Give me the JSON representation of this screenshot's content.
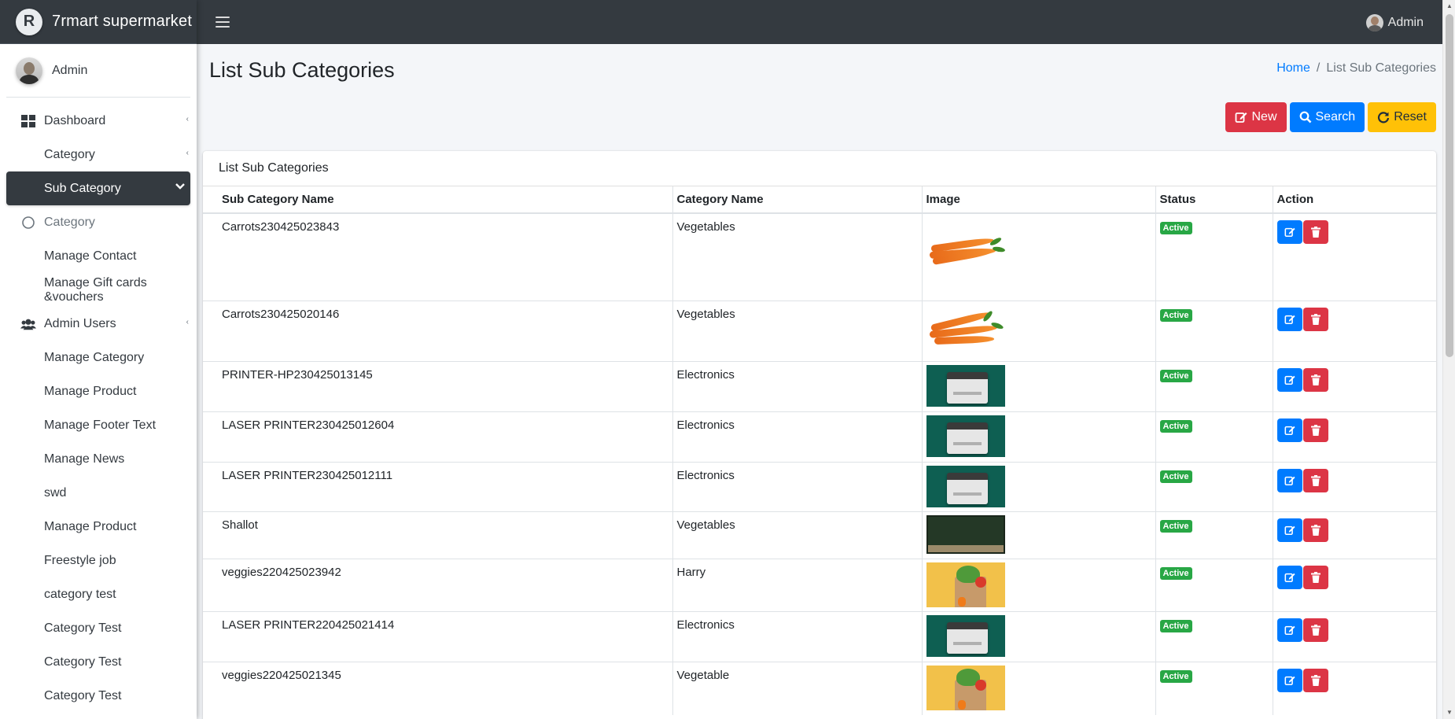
{
  "brand": {
    "name": "7rmart supermarket"
  },
  "sidebar": {
    "user": "Admin",
    "items": [
      {
        "label": "Dashboard"
      },
      {
        "label": "Category"
      },
      {
        "label": "Sub Category"
      },
      {
        "label": "Category"
      },
      {
        "label": "Manage Contact"
      },
      {
        "label": "Manage Gift cards &vouchers"
      },
      {
        "label": "Admin Users"
      },
      {
        "label": "Manage Category"
      },
      {
        "label": "Manage Product"
      },
      {
        "label": "Manage Footer Text"
      },
      {
        "label": "Manage News"
      },
      {
        "label": "swd"
      },
      {
        "label": "Manage Product"
      },
      {
        "label": "Freestyle job"
      },
      {
        "label": "category test"
      },
      {
        "label": "Category Test"
      },
      {
        "label": "Category Test"
      },
      {
        "label": "Category Test"
      }
    ]
  },
  "topbar": {
    "user": "Admin"
  },
  "page": {
    "title": "List Sub Categories",
    "breadcrumb": {
      "home": "Home",
      "current": "List Sub Categories"
    }
  },
  "toolbar": {
    "new_label": "New",
    "search_label": "Search",
    "reset_label": "Reset"
  },
  "card": {
    "title": "List Sub Categories"
  },
  "table": {
    "headers": [
      "Sub Category Name",
      "Category Name",
      "Image",
      "Status",
      "Action"
    ],
    "rows": [
      {
        "name": "Carrots230425023843",
        "category": "Vegetables",
        "image": "carrots-image",
        "status": "Active"
      },
      {
        "name": "Carrots230425020146",
        "category": "Vegetables",
        "image": "carrots-image",
        "status": "Active"
      },
      {
        "name": "PRINTER-HP230425013145",
        "category": "Electronics",
        "image": "printer-image",
        "status": "Active"
      },
      {
        "name": "LASER PRINTER230425012604",
        "category": "Electronics",
        "image": "printer-image",
        "status": "Active"
      },
      {
        "name": "LASER PRINTER230425012111",
        "category": "Electronics",
        "image": "printer-image",
        "status": "Active"
      },
      {
        "name": "Shallot",
        "category": "Vegetables",
        "image": "shallot-image",
        "status": "Active"
      },
      {
        "name": "veggies220425023942",
        "category": "Harry",
        "image": "veggies-image",
        "status": "Active"
      },
      {
        "name": "LASER PRINTER220425021414",
        "category": "Electronics",
        "image": "printer-image",
        "status": "Active"
      },
      {
        "name": "veggies220425021345",
        "category": "Vegetable",
        "image": "veggies-image",
        "status": "Active"
      }
    ]
  },
  "colors": {
    "sidebar_active": "#343a40",
    "navbar": "#343a40",
    "btn_new": "#dc3545",
    "btn_search": "#007bff",
    "btn_reset": "#ffc107",
    "badge_active": "#28a745"
  }
}
